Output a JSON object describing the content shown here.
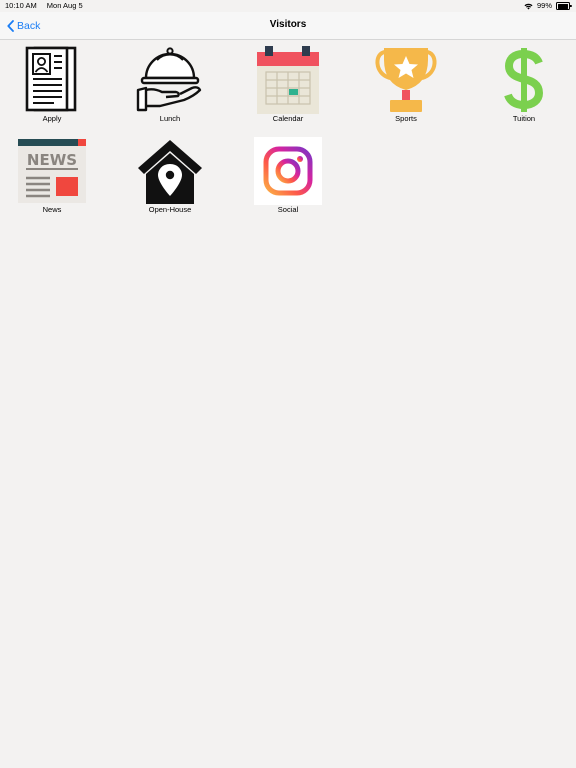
{
  "status_bar": {
    "time": "10:10 AM",
    "date": "Mon Aug 5",
    "battery": "99%",
    "battery_level": 0.99
  },
  "nav": {
    "back_label": "Back",
    "title": "Visitors"
  },
  "tiles": [
    {
      "label": "Apply",
      "icon": "application-form-icon"
    },
    {
      "label": "Lunch",
      "icon": "serving-tray-icon"
    },
    {
      "label": "Calendar",
      "icon": "calendar-icon"
    },
    {
      "label": "Sports",
      "icon": "trophy-icon"
    },
    {
      "label": "Tuition",
      "icon": "dollar-sign-icon"
    },
    {
      "label": "News",
      "icon": "newspaper-icon"
    },
    {
      "label": "Open-House",
      "icon": "house-location-icon"
    },
    {
      "label": "Social",
      "icon": "instagram-icon"
    }
  ],
  "colors": {
    "accent": "#1a7df5",
    "background": "#f3f2f1",
    "calendar_red": "#f0525e",
    "trophy_gold": "#f5b84a",
    "dollar_green": "#7bd04e",
    "news_red": "#f0473e"
  },
  "newspaper_masthead": "NEWS"
}
